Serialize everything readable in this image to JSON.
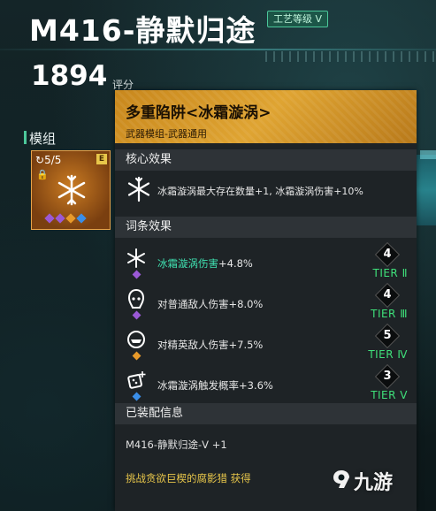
{
  "header": {
    "title": "M416-静默归途",
    "badge": "工艺等级 V",
    "score": "1894",
    "score_label": "评分"
  },
  "sidebar": {
    "section_label": "模组",
    "slot": {
      "count": "5/5",
      "tag": "E"
    }
  },
  "panel": {
    "title": "多重陷阱<冰霜漩涡>",
    "subtitle": "武器模组-武器通用",
    "core_header": "核心效果",
    "core_text": "冰霜漩涡最大存在数量+1, 冰霜漩涡伤害+10%",
    "affix_header": "词条效果",
    "affixes": [
      {
        "highlight": "冰霜漩涡伤害",
        "text": "+4.8%",
        "tier_num": "4",
        "tier": "TIER Ⅱ",
        "pip_color": "#9b59d6"
      },
      {
        "highlight": "",
        "text": "对普通敌人伤害+8.0%",
        "tier_num": "4",
        "tier": "TIER Ⅲ",
        "pip_color": "#9b59d6"
      },
      {
        "highlight": "",
        "text": "对精英敌人伤害+7.5%",
        "tier_num": "5",
        "tier": "TIER Ⅳ",
        "pip_color": "#e89a2a"
      },
      {
        "highlight": "",
        "text": "冰霜漩涡触发概率+3.6%",
        "tier_num": "3",
        "tier": "TIER Ⅴ",
        "pip_color": "#3a8ee8"
      }
    ],
    "equip_header": "已装配信息",
    "equip_text": "M416-静默归途-V +1",
    "source_text": "挑战贪欲巨楔的腐影猎 获得"
  },
  "watermark": {
    "text": "九游"
  },
  "colors": {
    "accent": "#4cc79a",
    "gold": "#dfa432",
    "tier_green": "#3fe07a",
    "highlight": "#3fe0b0"
  }
}
